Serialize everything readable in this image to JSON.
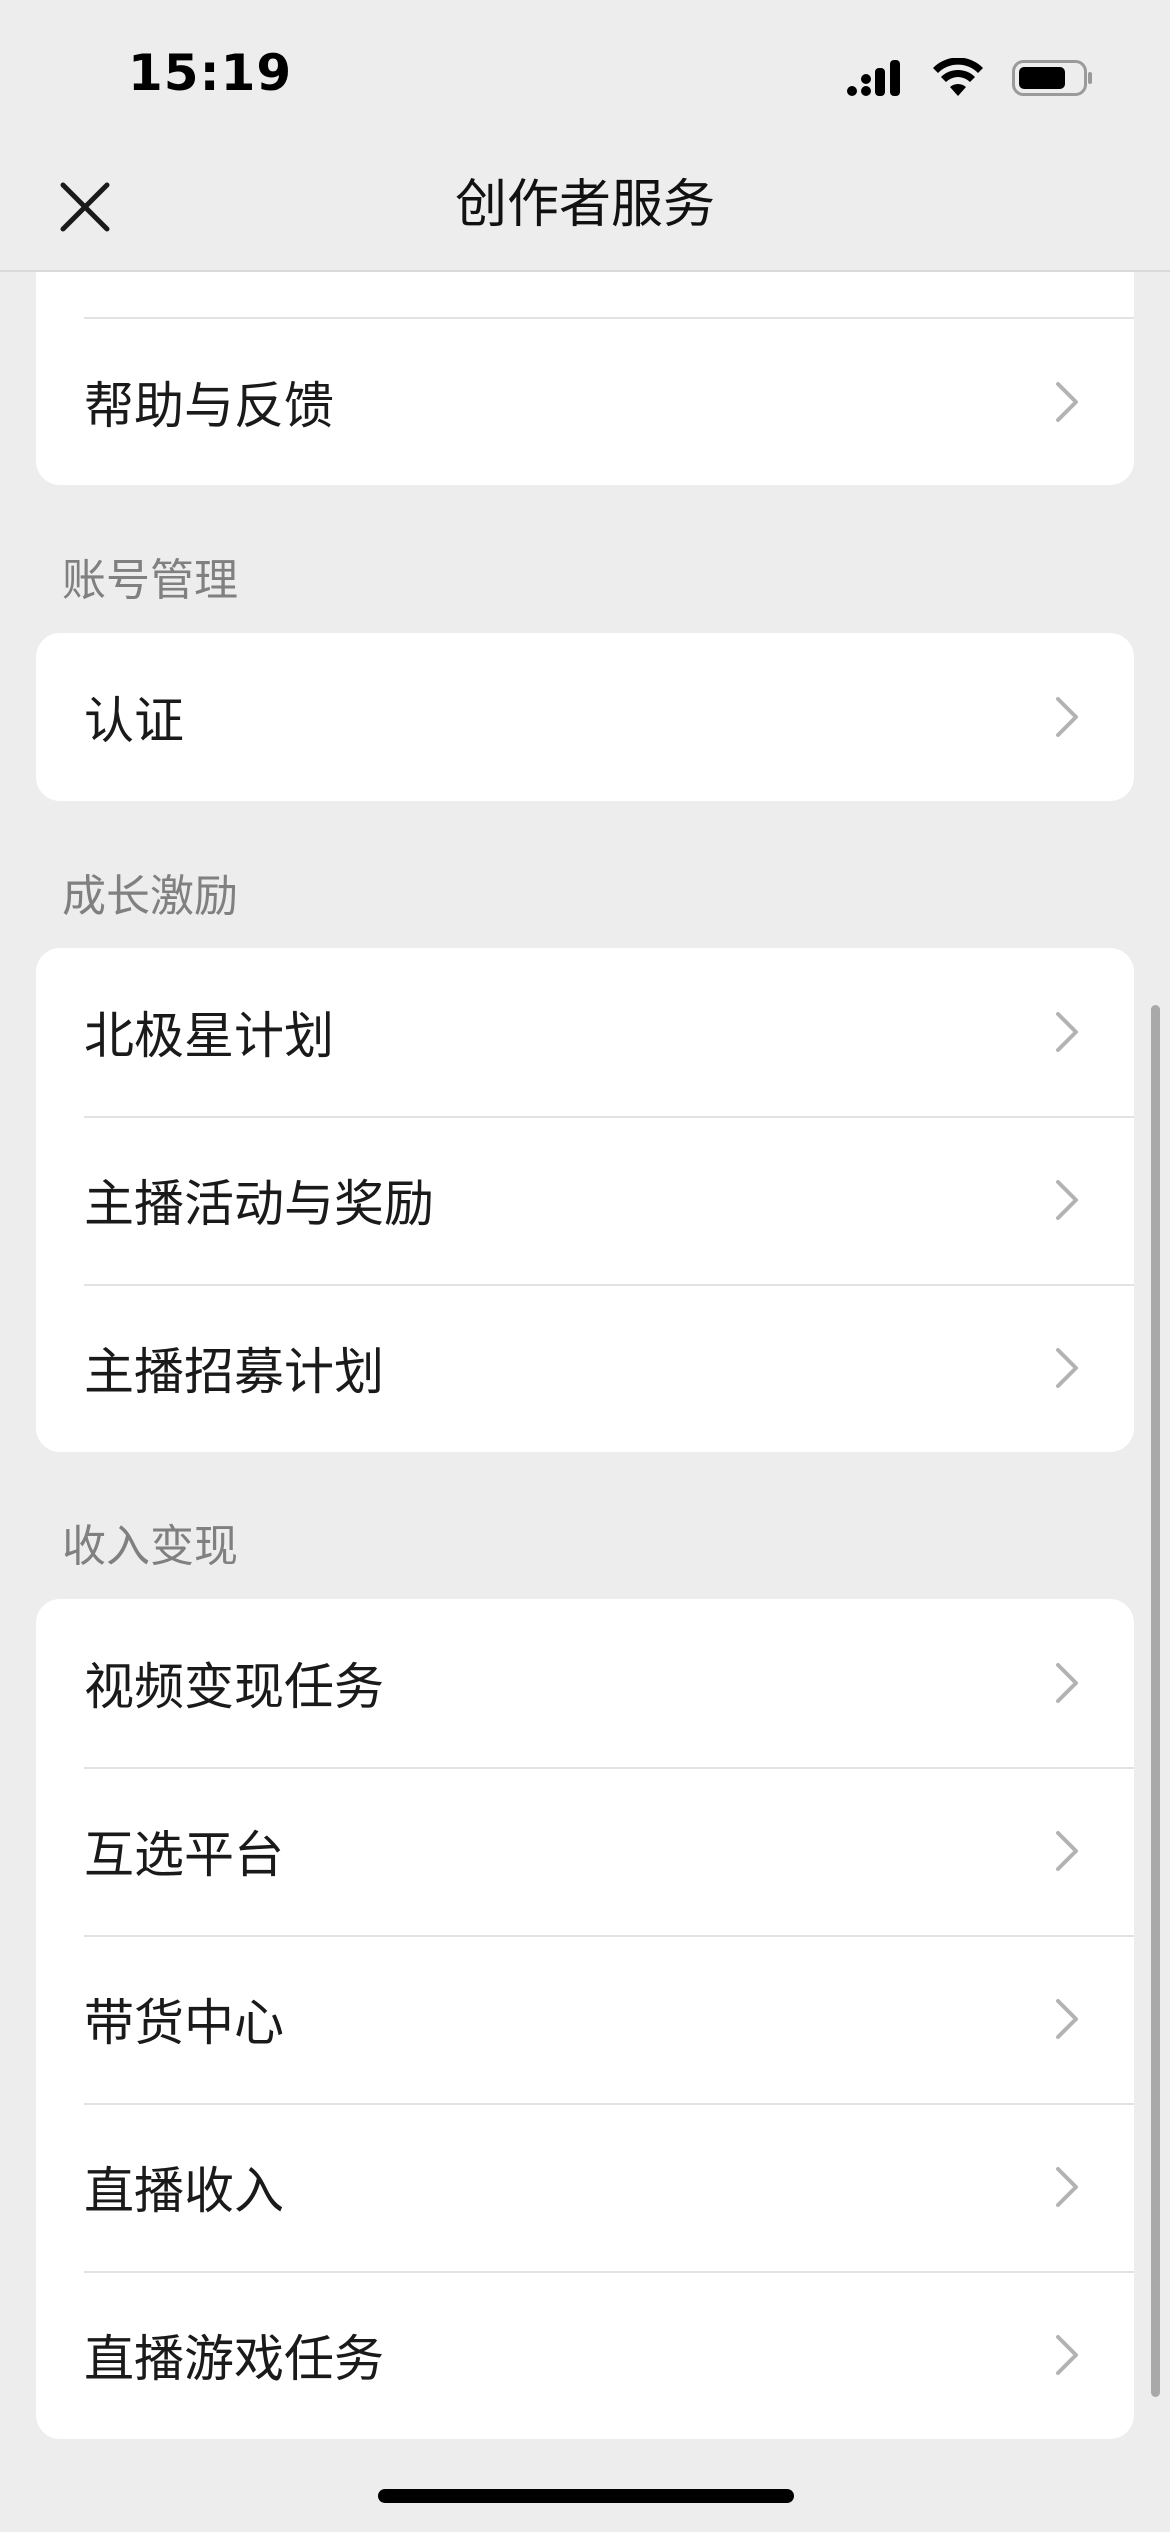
{
  "status_bar": {
    "time": "15:19",
    "icons": [
      "cellular-signal-icon",
      "wifi-icon",
      "battery-icon"
    ]
  },
  "nav": {
    "title": "创作者服务",
    "close_icon": "close-icon"
  },
  "sections": [
    {
      "title": "",
      "items": [
        {
          "label": "帮助与反馈"
        }
      ]
    },
    {
      "title": "账号管理",
      "items": [
        {
          "label": "认证"
        }
      ]
    },
    {
      "title": "成长激励",
      "items": [
        {
          "label": "北极星计划"
        },
        {
          "label": "主播活动与奖励"
        },
        {
          "label": "主播招募计划"
        }
      ]
    },
    {
      "title": "收入变现",
      "items": [
        {
          "label": "视频变现任务"
        },
        {
          "label": "互选平台"
        },
        {
          "label": "带货中心"
        },
        {
          "label": "直播收入"
        },
        {
          "label": "直播游戏任务"
        }
      ]
    }
  ],
  "colors": {
    "background": "#ededed",
    "card": "#ffffff",
    "section_title": "#808080",
    "chevron": "#b3b3b3"
  }
}
